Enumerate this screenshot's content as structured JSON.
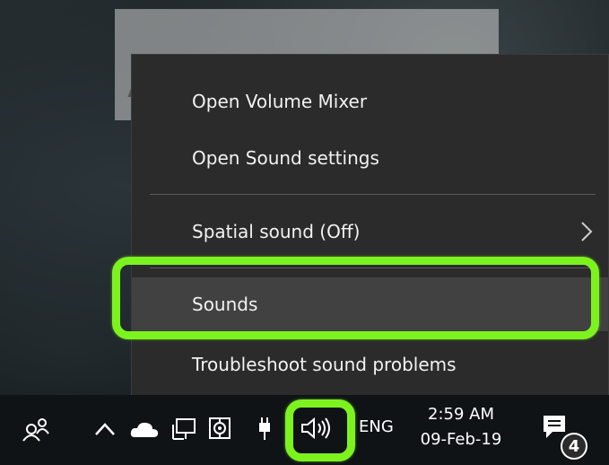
{
  "watermark": {
    "text": "APPUALS"
  },
  "context_menu": {
    "items": [
      {
        "label": "Open Volume Mixer"
      },
      {
        "label": "Open Sound settings"
      },
      {
        "label": "Spatial sound (Off)",
        "submenu_icon": "chevron-right-icon"
      },
      {
        "label": "Sounds",
        "state": "highlighted"
      },
      {
        "label": "Troubleshoot sound problems"
      }
    ]
  },
  "taskbar": {
    "icons": [
      "people-icon",
      "chevron-up-icon",
      "onedrive-cloud-icon",
      "network-icon",
      "security-icon",
      "power-plug-icon",
      "speaker-icon"
    ],
    "language": "ENG",
    "time": "2:59 AM",
    "date": "09-Feb-19",
    "notification_count": "4"
  },
  "colors": {
    "highlight": "#7cf31e",
    "menu_bg": "#2b2b2b",
    "taskbar_bg": "#101316"
  }
}
